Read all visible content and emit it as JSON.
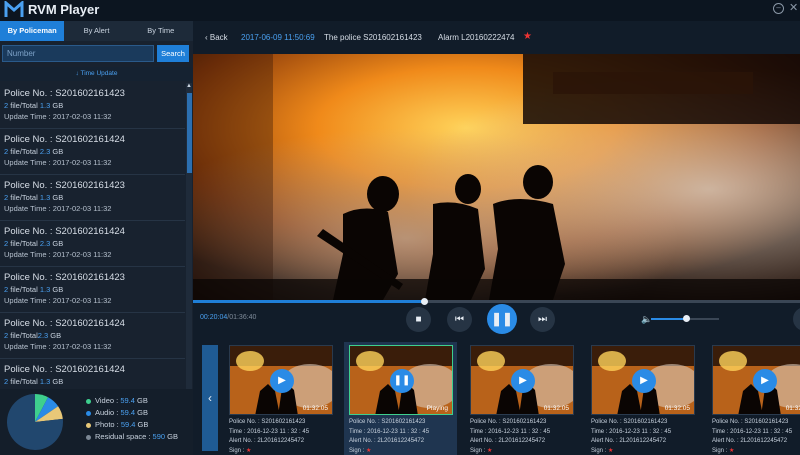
{
  "app": {
    "title": "RVM Player"
  },
  "window": {
    "minimize_icon": "minimize-icon",
    "close_icon": "close-icon"
  },
  "sidebar": {
    "tabs": [
      {
        "label": "By Policeman",
        "active": true
      },
      {
        "label": "By Alert",
        "active": false
      },
      {
        "label": "By Time",
        "active": false
      }
    ],
    "search": {
      "placeholder": "Number",
      "button_label": "Search"
    },
    "time_update_label": "↓ Time Update",
    "police_items": [
      {
        "police_no": "Police No. : S201602161423",
        "files": "2",
        "files_label": " file/Total ",
        "total": "1.3",
        "unit": " GB",
        "update_time": "Update Time : 2017-02-03 11:32"
      },
      {
        "police_no": "Police No. : S201602161424",
        "files": "2",
        "files_label": " file/Total ",
        "total": "2.3",
        "unit": " GB",
        "update_time": "Update Time : 2017-02-03 11:32"
      },
      {
        "police_no": "Police No. : S201602161423",
        "files": "2",
        "files_label": " file/Total ",
        "total": "1.3",
        "unit": " GB",
        "update_time": "Update Time : 2017-02-03 11:32"
      },
      {
        "police_no": "Police No. : S201602161424",
        "files": "2",
        "files_label": " file/Total ",
        "total": "2.3",
        "unit": " GB",
        "update_time": "Update Time : 2017-02-03 11:32"
      },
      {
        "police_no": "Police No. : S201602161423",
        "files": "2",
        "files_label": " file/Total ",
        "total": "1.3",
        "unit": " GB",
        "update_time": "Update Time : 2017-02-03 11:32"
      },
      {
        "police_no": "Police No. : S201602161424",
        "files": "2",
        "files_label": " file/Total",
        "total": "2.3",
        "unit": " GB",
        "update_time": "Update Time : 2017-02-03 11:32"
      },
      {
        "police_no": "Police No. : S201602161424",
        "files": "2",
        "files_label": " file/Total ",
        "total": "1.3",
        "unit": " GB",
        "update_time": ""
      }
    ],
    "storage": {
      "slices": [
        {
          "name": "Video",
          "value": 59.4,
          "color": "#3ecf8e"
        },
        {
          "name": "Audio",
          "value": 59.4,
          "color": "#2a8be6"
        },
        {
          "name": "Photo",
          "value": 59.4,
          "color": "#e8c878"
        },
        {
          "name": "Residual space",
          "value": 590,
          "color": "#21476e"
        }
      ],
      "legend": [
        {
          "label": "Video : ",
          "value": "59.4",
          "unit": " GB",
          "color": "#3ecf8e"
        },
        {
          "label": "Audio : ",
          "value": "59.4",
          "unit": " GB",
          "color": "#2a8be6"
        },
        {
          "label": "Photo : ",
          "value": "59.4",
          "unit": " GB",
          "color": "#e8c878"
        },
        {
          "label": "Residual space : ",
          "value": "590",
          "unit": " GB",
          "color": "#7b8794"
        }
      ]
    }
  },
  "player": {
    "back_label": "Back",
    "date": "2017-06-09 11:50:69",
    "police": "The police S201602161423",
    "alarm": "Alarm  L20160222474",
    "star": "★",
    "progress_fraction": 0.38,
    "time_current": "00:20:04",
    "time_separator": "/",
    "time_total": "01:36:40",
    "volume_fraction": 0.52
  },
  "clips": [
    {
      "duration": "01:32:05",
      "status": "",
      "police_no": "Police No. : S201602161423",
      "time": "Time : 2016-12-23 11 : 32 : 45",
      "alert_no": "Alert No. : 2L201612245472",
      "sign_label": "Sign : ",
      "selected": false
    },
    {
      "duration": "",
      "status": "Playing",
      "police_no": "Police No. : S201602161423",
      "time": "Time : 2016-12-23 11 : 32 : 45",
      "alert_no": "Alert No. : 2L201612245472",
      "sign_label": "Sign : ",
      "selected": true
    },
    {
      "duration": "01:32:05",
      "status": "",
      "police_no": "Police No. : S201602161423",
      "time": "Time : 2016-12-23 11 : 32 : 45",
      "alert_no": "Alert No. : 2L201612245472",
      "sign_label": "Sign : ",
      "selected": false
    },
    {
      "duration": "01:32:05",
      "status": "",
      "police_no": "Police No. : S201602161423",
      "time": "Time : 2016-12-23 11 : 32 : 45",
      "alert_no": "Alert No. : 2L201612245472",
      "sign_label": "Sign : ",
      "selected": false
    },
    {
      "duration": "01:32:05",
      "status": "",
      "police_no": "Police No. : S201602161423",
      "time": "Time : 2016-12-23 11 : 32 : 45",
      "alert_no": "Alert No. : 2L201612245472",
      "sign_label": "Sign : ",
      "selected": false
    }
  ]
}
